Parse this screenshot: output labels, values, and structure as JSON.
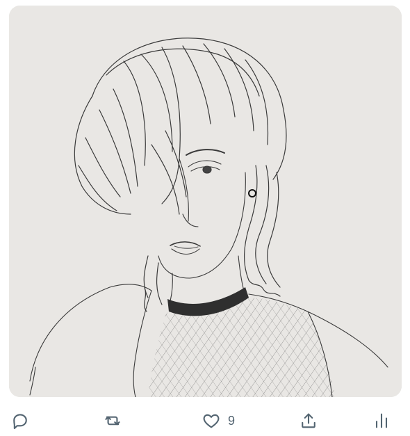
{
  "tweet": {
    "media": {
      "icon": "pencil-sketch-portrait"
    },
    "actions": {
      "reply": {
        "icon": "reply-icon"
      },
      "retweet": {
        "icon": "retweet-icon"
      },
      "like": {
        "icon": "heart-icon",
        "count": "9"
      },
      "share": {
        "icon": "share-icon"
      },
      "analytics": {
        "icon": "analytics-icon"
      }
    }
  },
  "colors": {
    "icon": "#536471",
    "paper": "#e9e7e4",
    "pencil": "#2f2f2f"
  }
}
